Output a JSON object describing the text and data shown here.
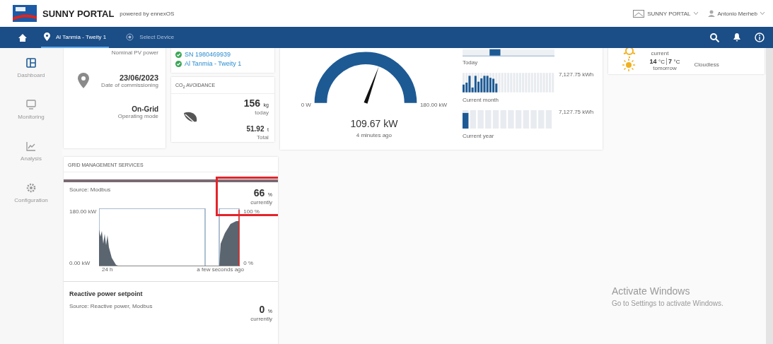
{
  "header": {
    "brand": "SUNNY PORTAL",
    "tagline": "powered by ennexOS",
    "portal_menu": "SUNNY PORTAL",
    "user_menu": "Antonio Merheb"
  },
  "nav": {
    "items": [
      {
        "kind": "location",
        "label": "Al Tanmia - Tweity 1",
        "selected": true
      },
      {
        "kind": "device",
        "label": "Select Device",
        "selected": false
      }
    ]
  },
  "sidebar": {
    "items": [
      {
        "kind": "dashboard",
        "label": "Dashboard",
        "selected": true
      },
      {
        "kind": "monitoring",
        "label": "Monitoring",
        "selected": false
      },
      {
        "kind": "analysis",
        "label": "Analysis",
        "selected": false
      },
      {
        "kind": "configuration",
        "label": "Configuration",
        "selected": false
      }
    ]
  },
  "plant_info": {
    "nominal_power_label": "Nominal PV power",
    "commissioning_date": "23/06/2023",
    "commissioning_label": "Date of commissioning",
    "operating_mode": "On-Grid",
    "operating_mode_label": "Operating mode"
  },
  "devices": [
    {
      "label": "SN 1980469939",
      "ok": true
    },
    {
      "label": "Al Tanmia - Tweity 1",
      "ok": true
    }
  ],
  "co2": {
    "title": "CO$_{2}$ AVOIDANCE",
    "today": {
      "value": "156",
      "unit": "kg",
      "label": "today"
    },
    "total": {
      "value": "51.92",
      "unit": "t",
      "label": "Total"
    }
  },
  "power": {
    "min_label": "0 W",
    "max_label": "180.00 kW",
    "level": 0.61,
    "value": "109.67 kW",
    "updated": "4 minutes ago"
  },
  "yield": [
    {
      "kind": "day",
      "label": "Today"
    },
    {
      "kind": "month",
      "label": "Current month",
      "reading": "7,127.75 kWh"
    },
    {
      "kind": "year",
      "label": "Current year",
      "reading": "7,127.75 kWh"
    }
  ],
  "weather": {
    "current_label": "current",
    "high": "14",
    "high_unit": "°C",
    "low": "7",
    "low_unit": "°C",
    "tomorrow_label": "tomorrow",
    "condition": "Cloudless"
  },
  "grid_management": {
    "title": "GRID MANAGEMENT SERVICES",
    "active_power": {
      "source": "Source: Modbus",
      "value": "66",
      "unit": "%",
      "label": "currently",
      "y_max": "180.00 kW",
      "y_min": "0.00 kW",
      "x_start": "24 h",
      "x_end": "a few seconds ago",
      "right_max": "100 %",
      "right_min": "0 %",
      "highlighted": true
    },
    "reactive_power": {
      "title": "Reactive power setpoint",
      "source": "Source: Reactive power, Modbus",
      "value": "0",
      "unit": "%",
      "label": "currently"
    }
  },
  "os_notice": {
    "title": "Activate Windows",
    "text": "Go to Settings to activate Windows."
  }
}
